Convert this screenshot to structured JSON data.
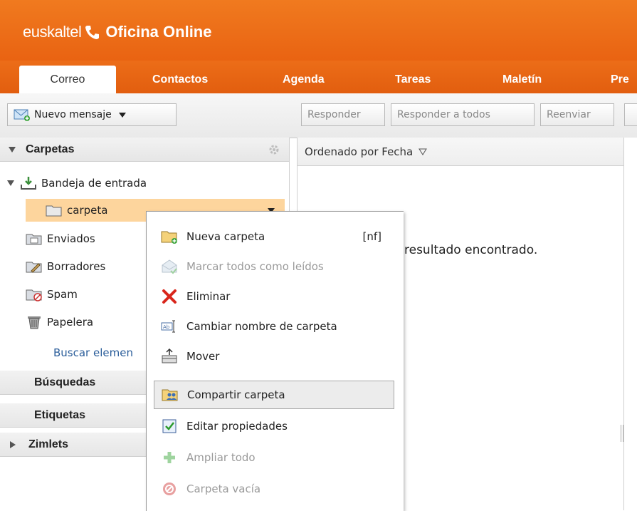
{
  "header": {
    "brand": "euskaltel",
    "product": "Oficina Online"
  },
  "tabs": [
    {
      "label": "Correo",
      "active": true
    },
    {
      "label": "Contactos",
      "active": false
    },
    {
      "label": "Agenda",
      "active": false
    },
    {
      "label": "Tareas",
      "active": false
    },
    {
      "label": "Maletín",
      "active": false
    },
    {
      "label": "Pre",
      "active": false
    }
  ],
  "toolbar": {
    "new_message": "Nuevo mensaje",
    "reply": "Responder",
    "reply_all": "Responder a todos",
    "forward": "Reenviar"
  },
  "sidebar": {
    "folders_header": "Carpetas",
    "inbox": "Bandeja de entrada",
    "subfolder": "carpeta",
    "sent": "Enviados",
    "drafts": "Borradores",
    "spam": "Spam",
    "trash": "Papelera",
    "search_link": "Buscar elemen",
    "searches": "Búsquedas",
    "tags": "Etiquetas",
    "zimlets": "Zimlets"
  },
  "list": {
    "sort_label": "Ordenado por Fecha",
    "empty_message": "resultado encontrado."
  },
  "context_menu": {
    "items": [
      {
        "label": "Nueva carpeta",
        "shortcut": "[nf]",
        "enabled": true,
        "icon": "new-folder-icon"
      },
      {
        "label": "Marcar todos como leídos",
        "enabled": false,
        "icon": "mark-read-icon"
      },
      {
        "label": "Eliminar",
        "enabled": true,
        "icon": "delete-x-icon"
      },
      {
        "label": "Cambiar nombre de carpeta",
        "enabled": true,
        "icon": "rename-icon"
      },
      {
        "label": "Mover",
        "enabled": true,
        "icon": "move-icon"
      },
      {
        "label": "Compartir carpeta",
        "enabled": true,
        "highlighted": true,
        "icon": "share-folder-icon"
      },
      {
        "label": "Editar propiedades",
        "enabled": true,
        "icon": "edit-properties-icon"
      },
      {
        "label": "Ampliar todo",
        "enabled": false,
        "icon": "expand-plus-icon"
      },
      {
        "label": "Carpeta vacía",
        "enabled": false,
        "icon": "empty-folder-icon"
      }
    ]
  },
  "colors": {
    "brand_orange": "#eb6a16",
    "selected_folder": "#fdd59d",
    "delete_red": "#d9261c"
  }
}
